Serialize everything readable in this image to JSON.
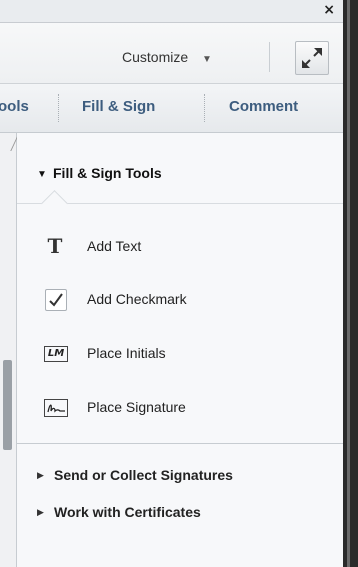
{
  "window": {
    "close_glyph": "×"
  },
  "toolbar": {
    "customize_label": "Customize",
    "customize_caret": "▼"
  },
  "tabs": [
    {
      "label": "ools"
    },
    {
      "label": "Fill & Sign"
    },
    {
      "label": "Comment"
    }
  ],
  "fill_sign": {
    "title": "Fill & Sign Tools",
    "expand_glyph": "▼",
    "tools": [
      {
        "label": "Add Text",
        "icon": "text-tool-icon",
        "glyph": "T"
      },
      {
        "label": "Add Checkmark",
        "icon": "checkmark-icon",
        "glyph": "✓"
      },
      {
        "label": "Place Initials",
        "icon": "initials-icon",
        "glyph": "LM"
      },
      {
        "label": "Place Signature",
        "icon": "signature-icon",
        "glyph": ""
      }
    ]
  },
  "panels": [
    {
      "label": "Send or Collect Signatures",
      "collapse_glyph": "▶"
    },
    {
      "label": "Work with Certificates",
      "collapse_glyph": "▶"
    }
  ],
  "colors": {
    "tab_text": "#3d5d7f",
    "pane_bg": "#f7f8fa"
  }
}
